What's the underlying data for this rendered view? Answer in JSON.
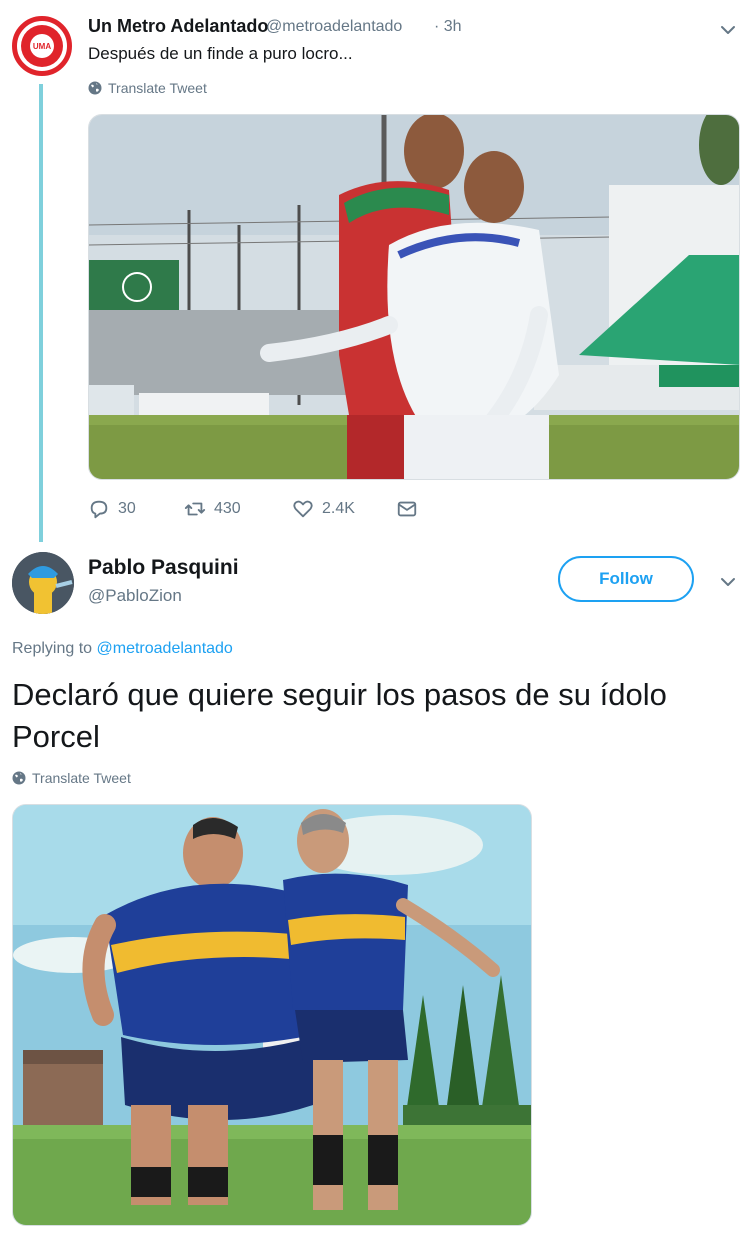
{
  "tweet1": {
    "display_name": "Un Metro Adelantado",
    "handle": "@metroadelantado",
    "time": "· 3h",
    "avatar_text": "UMA",
    "text": "Después de un finde a puro locro...",
    "translate_label": "Translate Tweet",
    "replies": "30",
    "retweets": "430",
    "likes": "2.4K"
  },
  "tweet2": {
    "display_name": "Pablo Pasquini",
    "handle": "@PabloZion",
    "follow_label": "Follow",
    "replying_prefix": "Replying to",
    "replying_to": "@metroadelantado",
    "text": "Declaró que quiere seguir los pasos de su ídolo Porcel",
    "translate_label": "Translate Tweet"
  },
  "colors": {
    "accent": "#1da1f2",
    "thread_line": "#7fd0dc",
    "secondary_text": "#657786",
    "uma_red": "#e0242b"
  },
  "icons": [
    "chevron-down-icon",
    "globe-icon",
    "reply-icon",
    "retweet-icon",
    "like-icon",
    "dm-icon"
  ]
}
